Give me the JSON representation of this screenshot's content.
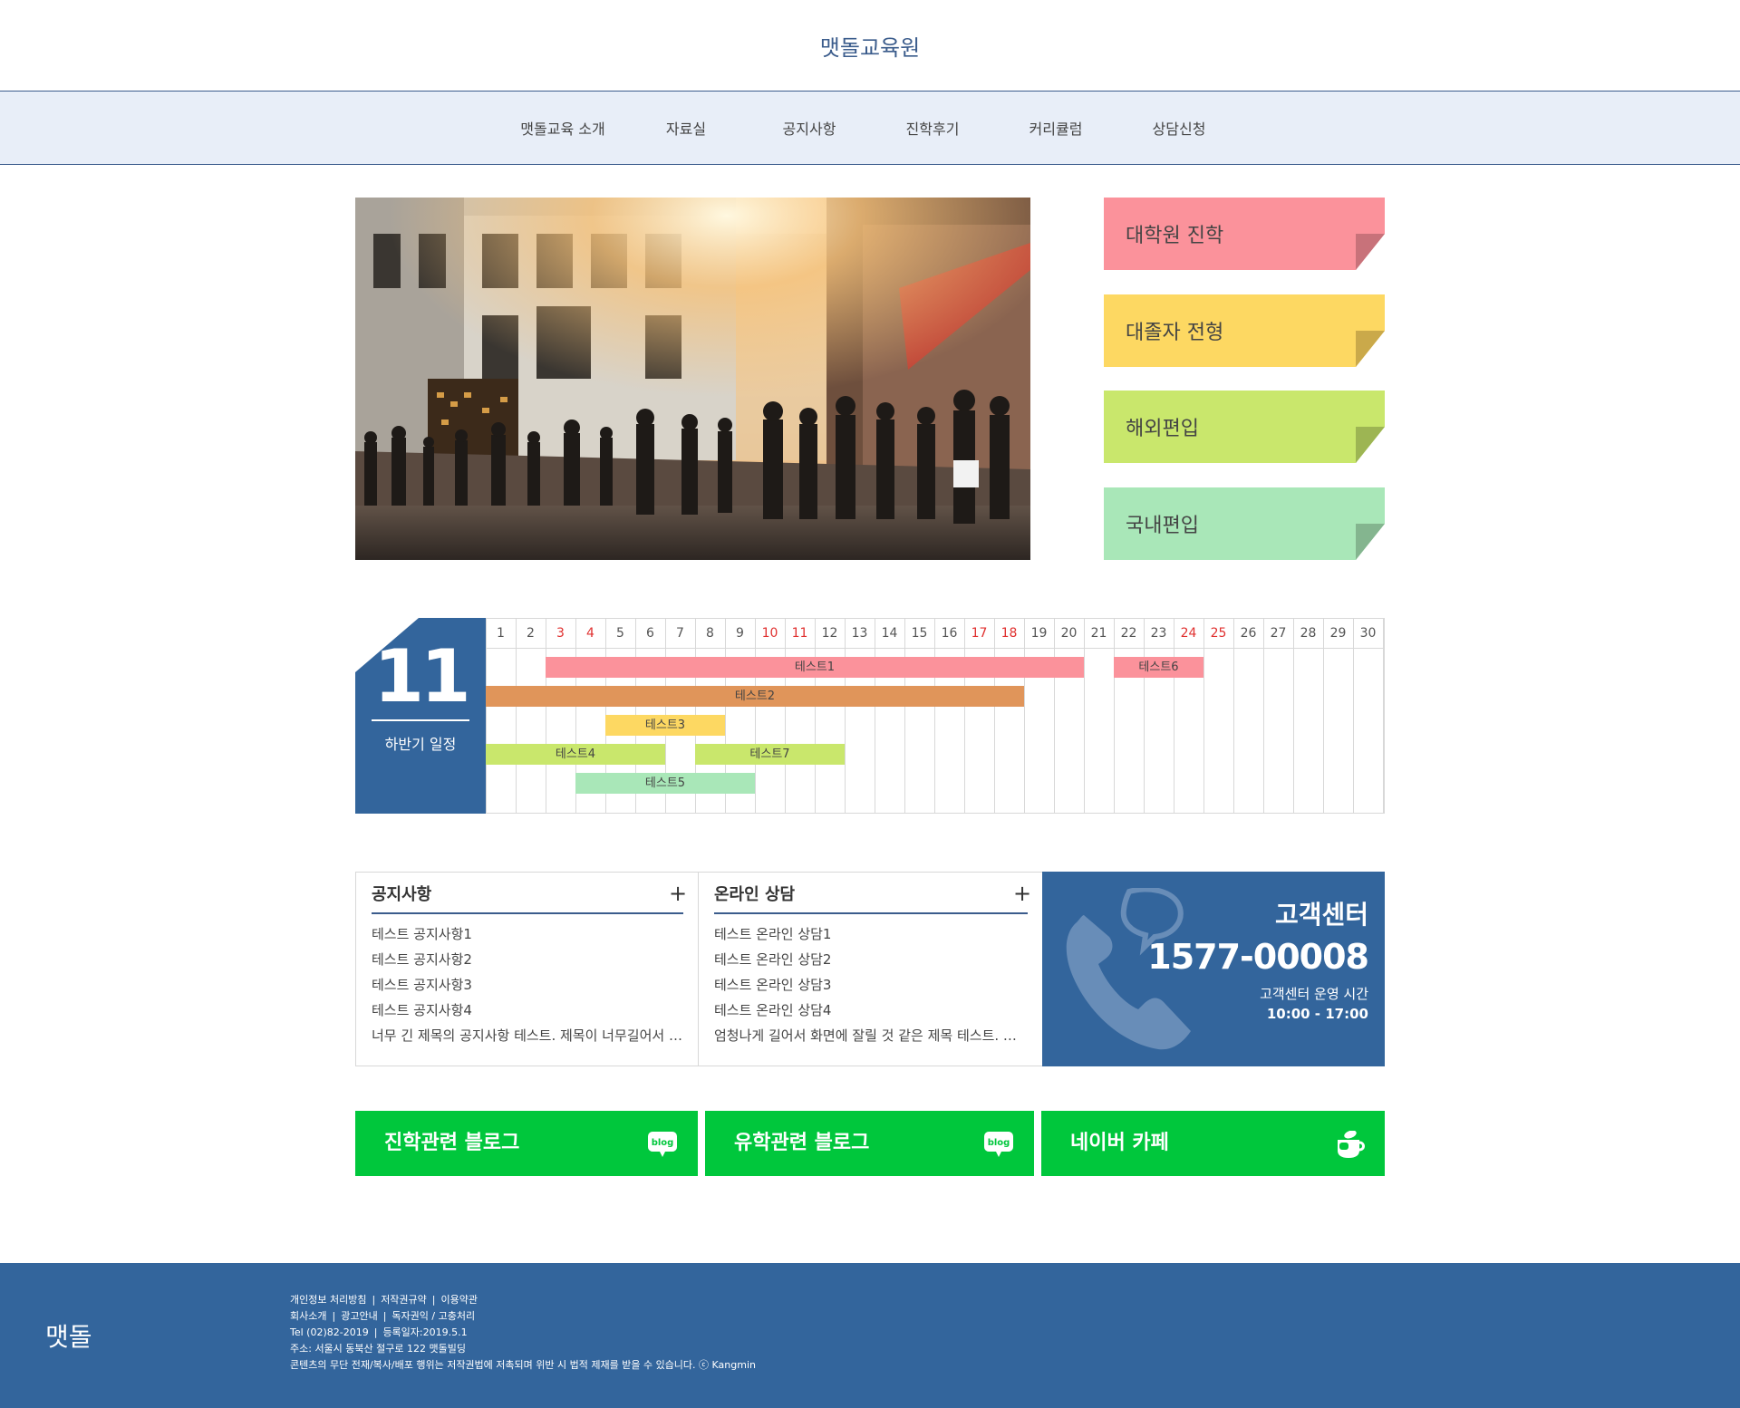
{
  "header": {
    "title": "맷돌교육원"
  },
  "nav": {
    "items": [
      "맷돌교육 소개",
      "자료실",
      "공지사항",
      "진학후기",
      "커리큘럼",
      "상담신청"
    ]
  },
  "quick_links": [
    {
      "label": "대학원 진학",
      "color": "#fb929b",
      "fold": "#c8727a"
    },
    {
      "label": "대졸자 전형",
      "color": "#fdd862",
      "fold": "#caa94a"
    },
    {
      "label": "해외편입",
      "color": "#c9e76c",
      "fold": "#9db553"
    },
    {
      "label": "국내편입",
      "color": "#a9e7b8",
      "fold": "#84b58f"
    }
  ],
  "calendar": {
    "month": "11",
    "subtitle": "하반기 일정",
    "days": [
      "1",
      "2",
      "3",
      "4",
      "5",
      "6",
      "7",
      "8",
      "9",
      "10",
      "11",
      "12",
      "13",
      "14",
      "15",
      "16",
      "17",
      "18",
      "19",
      "20",
      "21",
      "22",
      "23",
      "24",
      "25",
      "26",
      "27",
      "28",
      "29",
      "30"
    ],
    "red_days": [
      3,
      4,
      10,
      11,
      17,
      18,
      24,
      25
    ],
    "events": [
      {
        "label": "테스트1",
        "start": 3,
        "end": 20,
        "row": 0,
        "color": "#fb929b"
      },
      {
        "label": "테스트6",
        "start": 22,
        "end": 24,
        "row": 0,
        "color": "#fb929b"
      },
      {
        "label": "테스트2",
        "start": 1,
        "end": 18,
        "row": 1,
        "color": "#e0955a"
      },
      {
        "label": "테스트3",
        "start": 5,
        "end": 8,
        "row": 2,
        "color": "#fdd862"
      },
      {
        "label": "테스트4",
        "start": 1,
        "end": 6,
        "row": 3,
        "color": "#c9e76c"
      },
      {
        "label": "테스트7",
        "start": 8,
        "end": 12,
        "row": 3,
        "color": "#c9e76c"
      },
      {
        "label": "테스트5",
        "start": 4,
        "end": 9,
        "row": 4,
        "color": "#a9e7b8"
      }
    ]
  },
  "notice": {
    "title": "공지사항",
    "plus": "+",
    "items": [
      "테스트 공지사항1",
      "테스트 공지사항2",
      "테스트 공지사항3",
      "테스트 공지사항4",
      "너무 긴 제목의 공지사항 테스트. 제목이 너무길어서 화면에"
    ]
  },
  "consult": {
    "title": "온라인 상담",
    "plus": "+",
    "items": [
      "테스트 온라인 상담1",
      "테스트 온라인 상담2",
      "테스트 온라인 상담3",
      "테스트 온라인 상담4",
      "엄청나게 길어서 화면에 잘릴 것 같은 제목 테스트. 제목이"
    ]
  },
  "customer_center": {
    "title": "고객센터",
    "phone": "1577-00008",
    "hours_label": "고객센터 운영 시간",
    "hours": "10:00 - 17:00"
  },
  "green_links": [
    {
      "label": "진학관련 블로그",
      "icon": "blog-icon",
      "icon_text": "blog"
    },
    {
      "label": "유학관련 블로그",
      "icon": "blog-icon",
      "icon_text": "blog"
    },
    {
      "label": "네이버 카페",
      "icon": "cafe-icon"
    }
  ],
  "footer": {
    "logo": "맷돌",
    "links1": [
      "개인정보 처리방침",
      "저작권규약",
      "이용약관"
    ],
    "links2": [
      "회사소개",
      "광고안내",
      "독자권익 / 고충처리"
    ],
    "phone": "Tel (02)82-2019",
    "registered": "등록일자:2019.5.1",
    "address": "주소: 서울시 동북산 절구로 122 맷돌빌딩",
    "copyright": "콘텐츠의 무단 전재/복사/배포 행위는 저작권법에 저촉되며 위반 시 법적 제재를 받을 수 있습니다. ⓒ Kangmin",
    "separator": "|"
  }
}
